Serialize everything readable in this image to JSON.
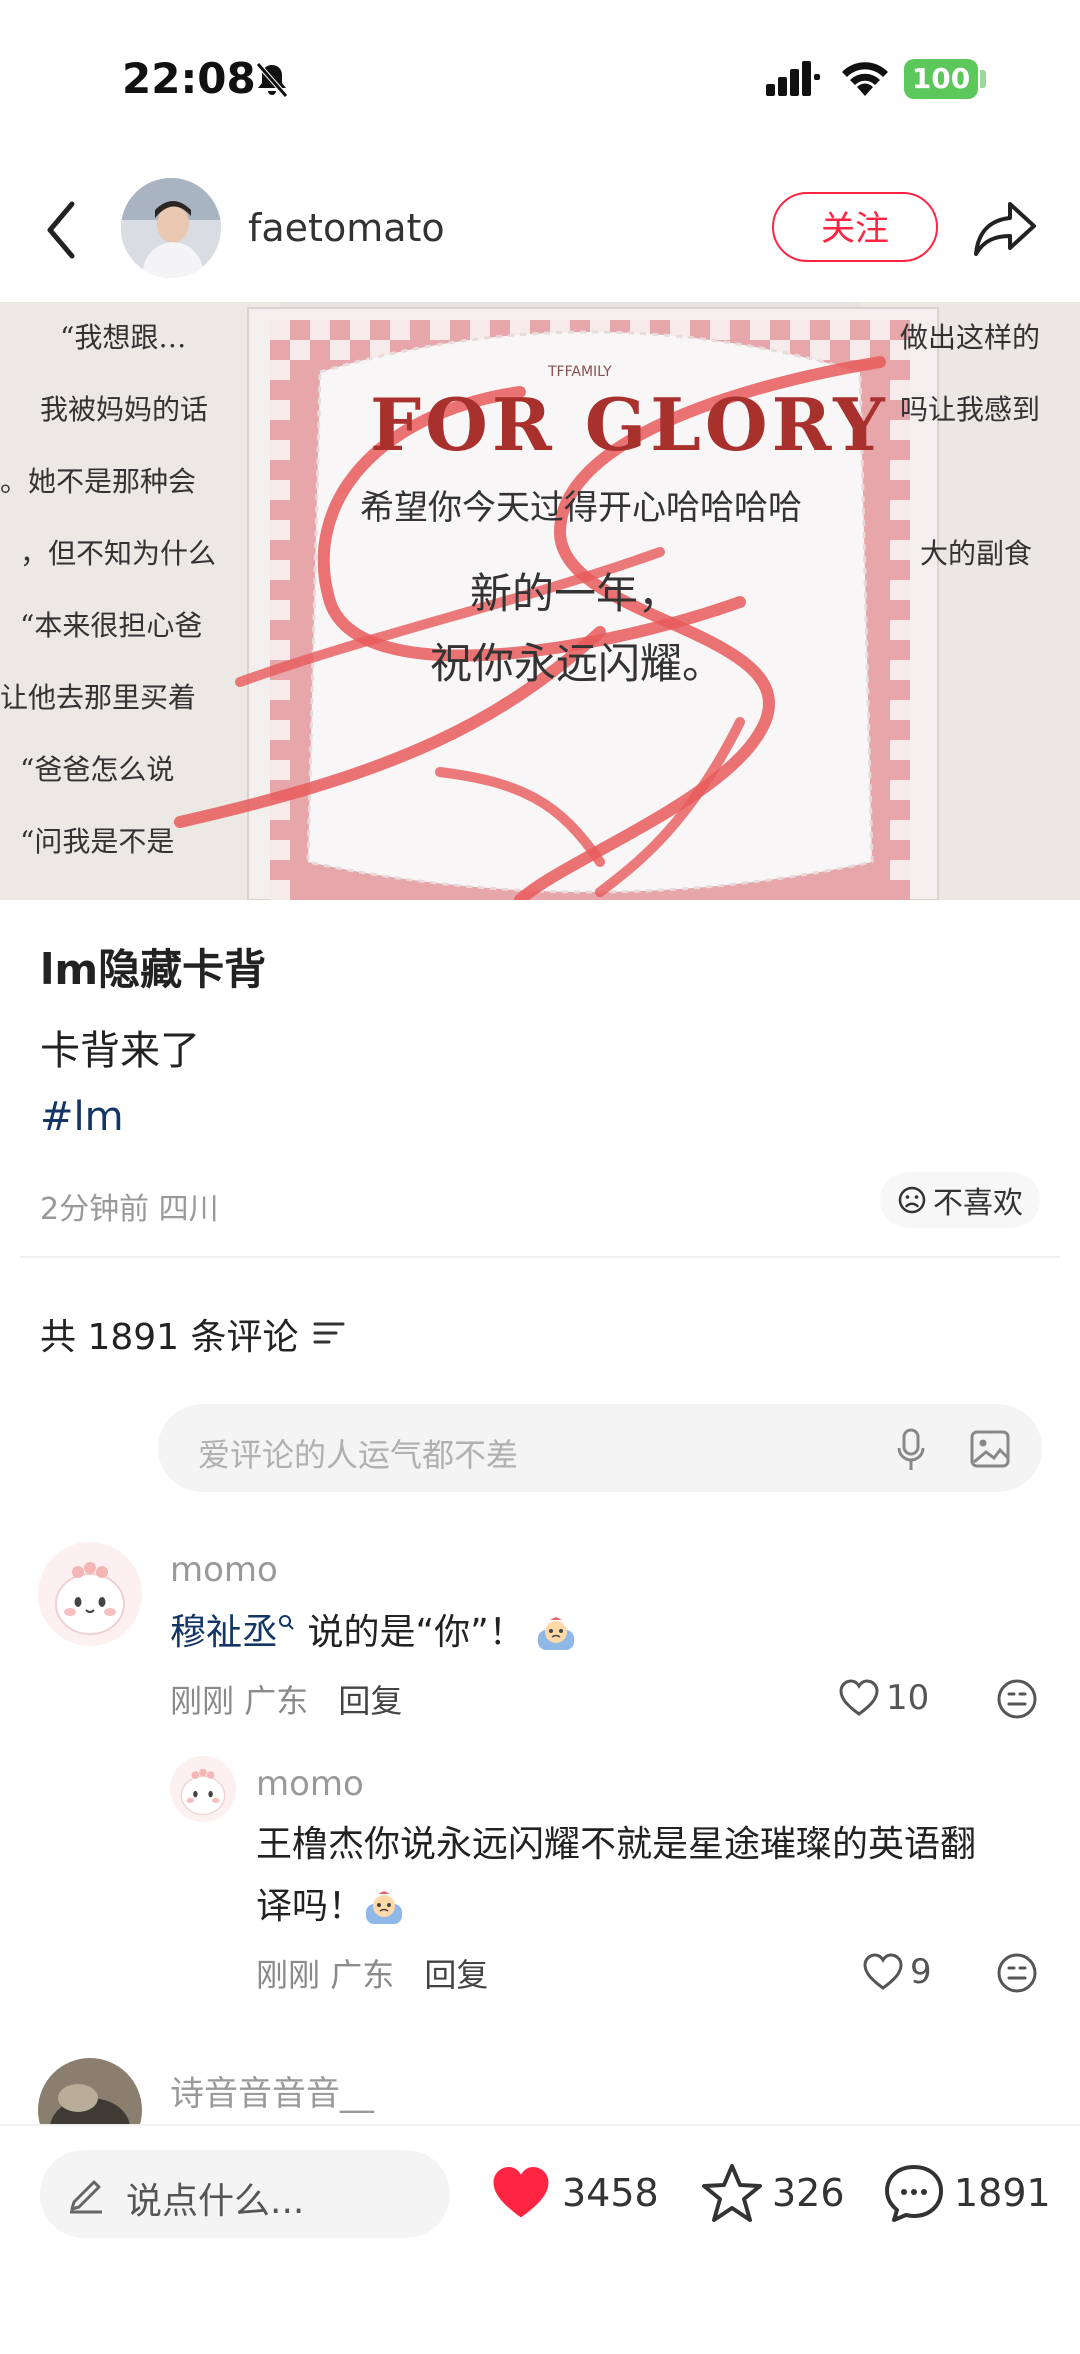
{
  "status": {
    "time": "22:08",
    "battery": "100"
  },
  "header": {
    "username": "faetomato",
    "follow_label": "关注"
  },
  "photo": {
    "card_title": "FOR GLORY",
    "card_brand": "TFFAMILY",
    "card_line1": "希望你今天过得开心哈哈哈哈",
    "card_line2": "新的一年，",
    "card_line3": "祝你永远闪耀。",
    "book_lines": [
      "“我想跟…",
      "我被妈妈的话",
      "。她不是那种会",
      "，但不知为什么",
      "“本来很担心爸",
      "让他去那里买着",
      "“爸爸怎么说",
      "“问我是不是"
    ],
    "book_lines_right": [
      "做出这样的",
      "吗让我感到",
      "大的副食"
    ]
  },
  "post": {
    "title": "lm隐藏卡背",
    "body": "卡背来了",
    "tag": "#lm",
    "meta": "2分钟前 四川",
    "dislike_label": "不喜欢"
  },
  "comments_section": {
    "count_label": "共 1891 条评论",
    "input_placeholder": "爱评论的人运气都不差"
  },
  "comments": [
    {
      "name": "momo",
      "mention": "穆祉丞",
      "text": "说的是“你”！",
      "time": "刚刚",
      "region": "广东",
      "reply_label": "回复",
      "likes": "10"
    },
    {
      "name": "momo",
      "text_line1": "王橹杰你说永远闪耀不就是星途璀璨的英语翻",
      "text_line2": "译吗！",
      "time": "刚刚",
      "region": "广东",
      "reply_label": "回复",
      "likes": "9"
    },
    {
      "name": "诗音音音音__"
    }
  ],
  "bottom_bar": {
    "input_placeholder": "说点什么...",
    "likes": "3458",
    "favorites": "326",
    "comments": "1891"
  },
  "colors": {
    "accent": "#ff2442",
    "link": "#133667",
    "battery": "#5cc85c"
  }
}
